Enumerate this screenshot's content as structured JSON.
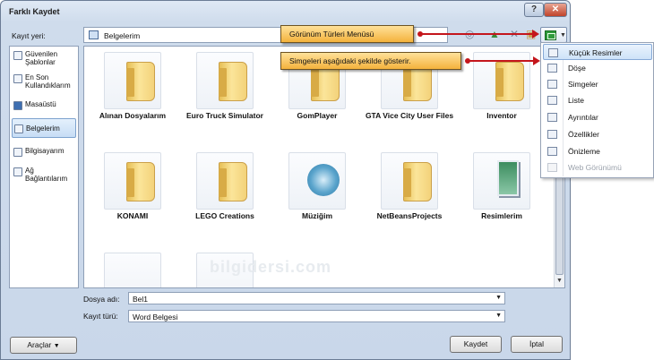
{
  "window": {
    "title": "Farklı Kaydet",
    "help": "?",
    "close": "✕"
  },
  "location": {
    "label": "Kayıt yeri:",
    "label_key": "K",
    "value": "Belgelerim"
  },
  "toolbar": {
    "icons": [
      "back-icon",
      "up-folder-icon",
      "delete-icon",
      "new-folder-icon",
      "views-icon"
    ]
  },
  "sidebar": {
    "items": [
      {
        "label": "Güvenilen\nŞablonlar",
        "icon": "trusted-templates-icon"
      },
      {
        "label": "En Son\nKullandıklarım",
        "icon": "recent-icon"
      },
      {
        "label": "Masaüstü",
        "icon": "desktop-icon"
      },
      {
        "label": "Belgelerim",
        "icon": "documents-icon",
        "selected": true
      },
      {
        "label": "Bilgisayarım",
        "icon": "computer-icon"
      },
      {
        "label": "Ağ\nBağlantılarım",
        "icon": "network-icon"
      }
    ]
  },
  "files": [
    {
      "name": "Alınan Dosyalarım",
      "kind": "folder"
    },
    {
      "name": "Euro Truck Simulator",
      "kind": "folder"
    },
    {
      "name": "GomPlayer",
      "kind": "folder"
    },
    {
      "name": "GTA Vice City User Files",
      "kind": "folder"
    },
    {
      "name": "Inventor",
      "kind": "folder"
    },
    {
      "name": "KONAMI",
      "kind": "folder"
    },
    {
      "name": "LEGO Creations",
      "kind": "folder"
    },
    {
      "name": "Müziğim",
      "kind": "music-folder"
    },
    {
      "name": "NetBeansProjects",
      "kind": "folder"
    },
    {
      "name": "Resimlerim",
      "kind": "pictures-folder"
    }
  ],
  "filename": {
    "label": "Dosya adı:",
    "value": "Bel1"
  },
  "filetype": {
    "label": "Kayıt türü:",
    "value": "Word Belgesi"
  },
  "buttons": {
    "tools": "Araçlar",
    "save": "Kaydet",
    "cancel": "İptal"
  },
  "callouts": {
    "views_menu": "Görünüm Türleri Menüsü",
    "icons_view": "Simgeleri aşağıdaki şekilde gösterir."
  },
  "view_menu": {
    "items": [
      {
        "label": "Küçük Resimler",
        "active": true
      },
      {
        "label": "Döşe"
      },
      {
        "label": "Simgeler"
      },
      {
        "label": "Liste"
      },
      {
        "label": "Ayrıntılar"
      },
      {
        "label": "Özellikler"
      },
      {
        "label": "Önizleme"
      },
      {
        "label": "Web Görünümü",
        "disabled": true
      }
    ]
  },
  "watermark": "bilgidersi.com",
  "colors": {
    "accent_arrow": "#c4161c",
    "callout_fill": "#f4b23c",
    "selection": "#cde2f8"
  }
}
